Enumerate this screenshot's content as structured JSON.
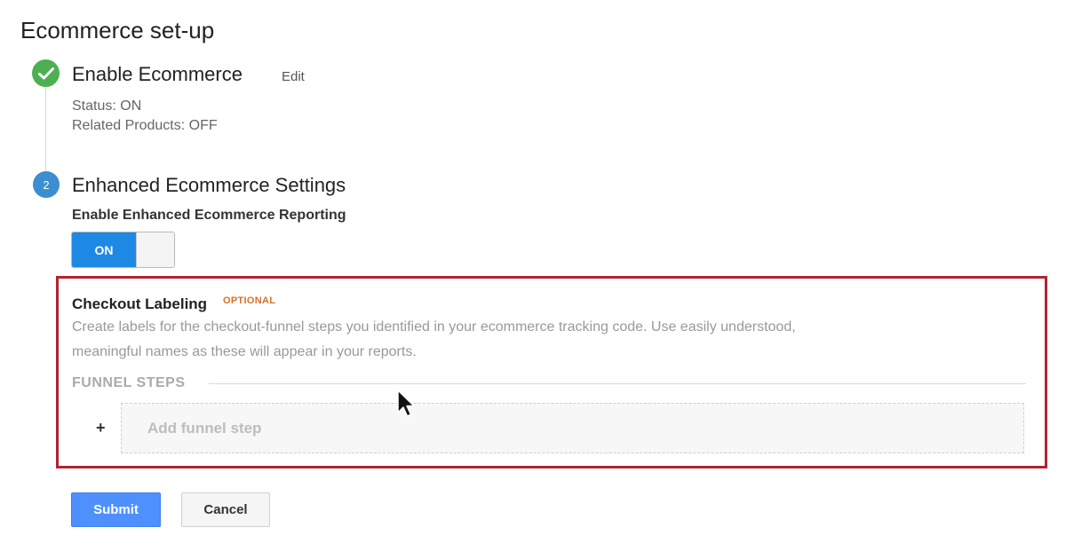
{
  "page": {
    "title": "Ecommerce set-up"
  },
  "step1": {
    "title": "Enable Ecommerce",
    "edit_label": "Edit",
    "status": "Status: ON",
    "related_products": "Related Products: OFF",
    "icon": "check-icon"
  },
  "step2": {
    "number": "2",
    "title": "Enhanced Ecommerce Settings",
    "enable_label": "Enable Enhanced Ecommerce Reporting",
    "toggle_label": "ON",
    "toggle_state": "on"
  },
  "checkout": {
    "title": "Checkout Labeling",
    "optional": "OPTIONAL",
    "description": "Create labels for the checkout-funnel steps you identified in your ecommerce tracking code. Use easily understood, meaningful names as these will appear in your reports.",
    "funnel_label": "FUNNEL STEPS",
    "add_icon": "+",
    "add_placeholder": "Add funnel step"
  },
  "actions": {
    "submit": "Submit",
    "cancel": "Cancel"
  },
  "colors": {
    "accent": "#1e88e5",
    "success": "#4caf50",
    "step": "#3b8ed0",
    "highlight": "#b02430",
    "optional": "#d9702a"
  }
}
